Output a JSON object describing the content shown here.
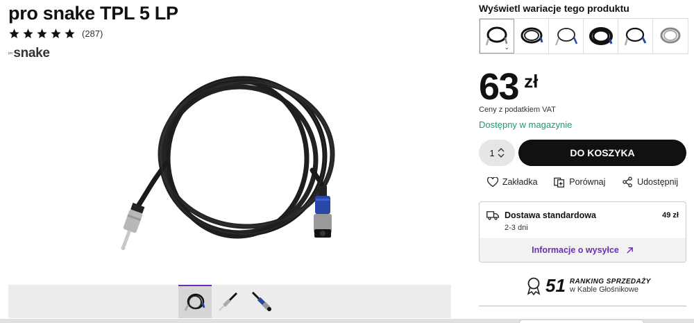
{
  "product": {
    "title": "pro snake TPL 5 LP",
    "rating_count": "(287)",
    "stars": 5,
    "brand_prefix": "pro",
    "brand": "snake"
  },
  "variants": {
    "title": "Wyświetl wariacje tego produktu"
  },
  "price": {
    "amount": "63",
    "currency": "zł",
    "vat_note": "Ceny z podatkiem VAT",
    "stock": "Dostępny w magazynie"
  },
  "cart": {
    "quantity": "1",
    "button_label": "DO KOSZYKA"
  },
  "actions": {
    "bookmark": "Zakładka",
    "compare": "Porównaj",
    "share": "Udostępnij"
  },
  "shipping": {
    "title": "Dostawa standardowa",
    "price": "49 zł",
    "days": "2-3 dni",
    "info_link": "Informacje o wysyłce"
  },
  "ranking": {
    "number": "51",
    "label": "RANKING SPRZEDAŻY",
    "category": "w Kable Głośnikowe"
  },
  "colors": {
    "accent": "#6b2fb3",
    "stock": "#1a9e6b",
    "button": "#111111"
  }
}
